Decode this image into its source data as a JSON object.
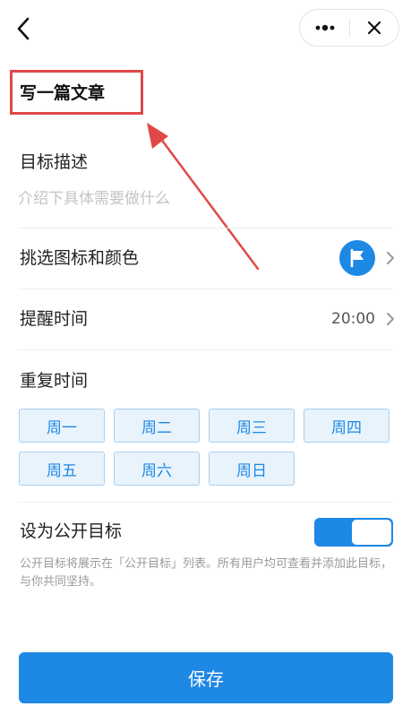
{
  "topbar": {
    "back_icon": "chevron-left-icon",
    "more_icon": "more-dots-icon",
    "close_icon": "close-icon"
  },
  "goal": {
    "title": "写一篇文章"
  },
  "description": {
    "label": "目标描述",
    "placeholder": "介绍下具体需要做什么",
    "value": ""
  },
  "icon_color": {
    "label": "挑选图标和颜色",
    "icon": "flag-icon",
    "color": "#1e88e5"
  },
  "reminder": {
    "label": "提醒时间",
    "value": "20:00"
  },
  "repeat": {
    "label": "重复时间",
    "days": [
      "周一",
      "周二",
      "周三",
      "周四",
      "周五",
      "周六",
      "周日"
    ]
  },
  "public": {
    "label": "设为公开目标",
    "enabled": true,
    "description": "公开目标将展示在「公开目标」列表。所有用户均可查看并添加此目标，与你共同坚持。"
  },
  "save": {
    "label": "保存"
  },
  "colors": {
    "accent": "#1e88e5",
    "annotation": "#e04848"
  }
}
